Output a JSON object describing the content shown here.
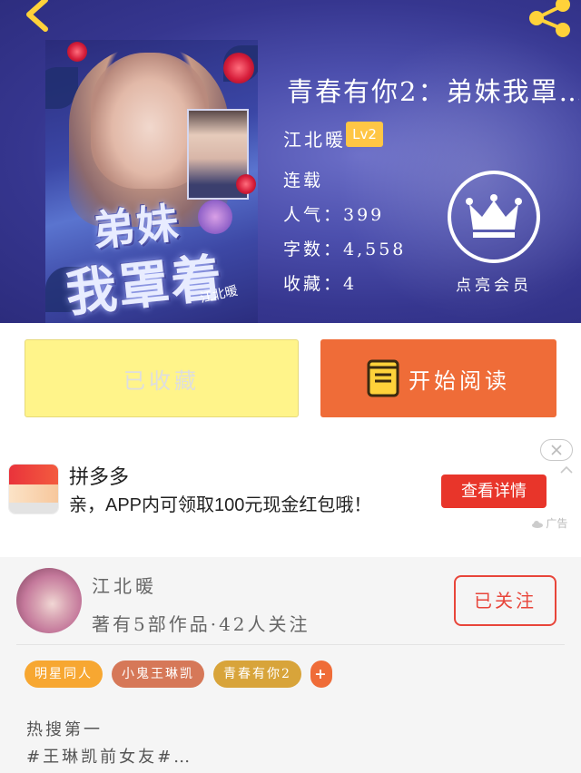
{
  "colors": {
    "header_bg": "#3a3a95",
    "accent_yellow": "#ffc645",
    "favorite_button": "#fff48a",
    "read_button": "#ef6c38",
    "ad_cta": "#e8352a",
    "follow": "#e8453a"
  },
  "header": {
    "back_icon": "chevron-left-icon",
    "share_icon": "share-icon"
  },
  "cover": {
    "title_line1": "弟妹",
    "title_line2": "我罩着",
    "seal_text": "",
    "author_tag": "江北暖"
  },
  "book": {
    "title": "青春有你2：弟妹我罩…",
    "author": "江北暖",
    "level": "Lv2",
    "status": "连载",
    "popularity": "人气：399",
    "word_count": "字数：4,558",
    "favorites": "收藏：4"
  },
  "vip": {
    "icon": "crown-icon",
    "label": "点亮会员"
  },
  "actions": {
    "favorite_label": "已收藏",
    "read_label": "开始阅读",
    "read_icon": "book-icon"
  },
  "ad": {
    "app_name": "拼多多",
    "description": "亲，APP内可领取100元现金红包哦！",
    "cta": "查看详情",
    "label": "广告",
    "close_icon": "close-icon",
    "collapse_icon": "chevron-up-icon"
  },
  "author_card": {
    "name": "江北暖",
    "stats": "著有5部作品·42人关注",
    "follow_label": "已关注",
    "tags": [
      {
        "label": "明星同人",
        "color": "#f7a731"
      },
      {
        "label": "小鬼王琳凯",
        "color": "#d67858"
      },
      {
        "label": "青春有你2",
        "color": "#d8a43a"
      }
    ],
    "add_tag_label": "+",
    "add_tag_color": "#ef6c38",
    "post_line1": "热搜第一",
    "post_line2": "#王琳凯前女友#…"
  }
}
